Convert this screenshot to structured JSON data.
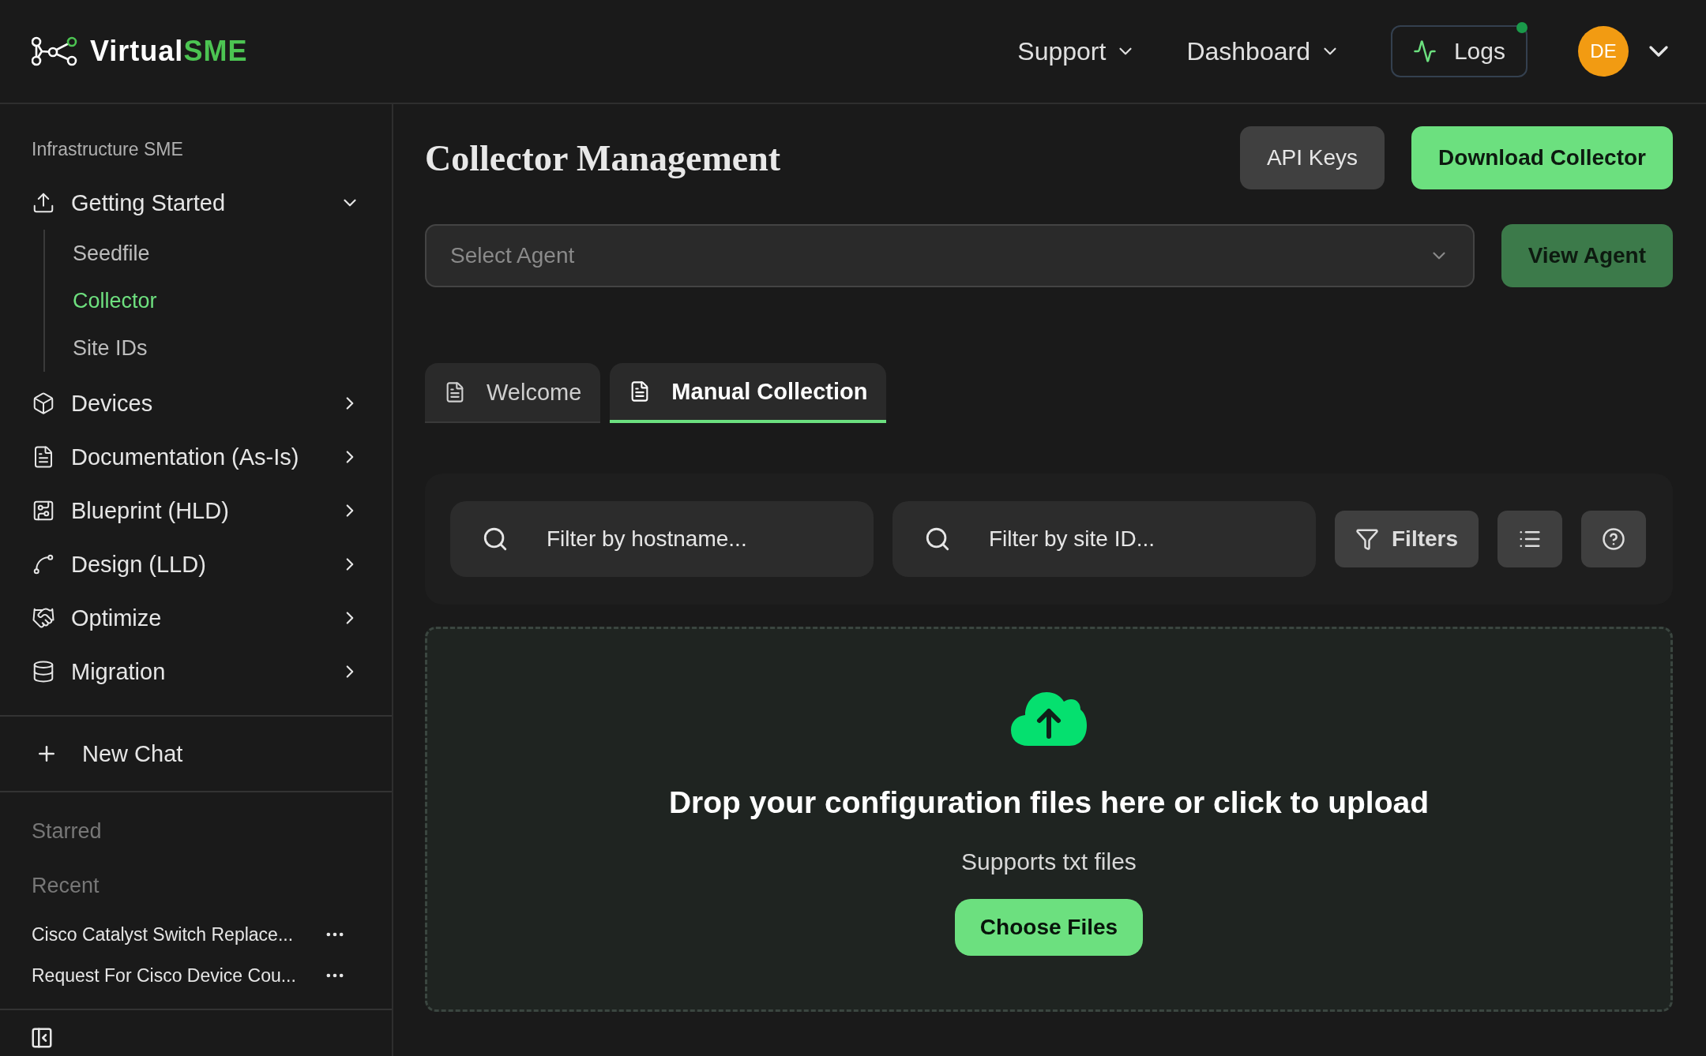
{
  "header": {
    "logo": {
      "part_1": "Virtual",
      "part_2": "SME"
    },
    "nav": [
      {
        "label": "Support"
      },
      {
        "label": "Dashboard"
      }
    ],
    "logs_button": {
      "label": "Logs",
      "notification": true
    },
    "avatar": {
      "initials": "DE"
    }
  },
  "sidebar": {
    "section_title": "Infrastructure SME",
    "items": [
      {
        "label": "Getting Started",
        "expanded": true,
        "children": [
          {
            "label": "Seedfile",
            "selected": false
          },
          {
            "label": "Collector",
            "selected": true
          },
          {
            "label": "Site IDs",
            "selected": false
          }
        ]
      },
      {
        "label": "Devices",
        "expanded": false
      },
      {
        "label": "Documentation (As-Is)",
        "expanded": false
      },
      {
        "label": "Blueprint (HLD)",
        "expanded": false
      },
      {
        "label": "Design (LLD)",
        "expanded": false
      },
      {
        "label": "Optimize",
        "expanded": false
      },
      {
        "label": "Migration",
        "expanded": false
      }
    ],
    "new_chat": "New Chat",
    "starred_title": "Starred",
    "recent_title": "Recent",
    "recent": [
      {
        "title": "Cisco Catalyst Switch Replace..."
      },
      {
        "title": "Request For Cisco Device Cou..."
      }
    ]
  },
  "main": {
    "title": "Collector Management",
    "buttons": [
      {
        "label": "API Keys",
        "kind": "secondary"
      },
      {
        "label": "Download Collector",
        "kind": "primary"
      }
    ],
    "agent_select": {
      "placeholder": "Select Agent"
    },
    "view_agent": "View Agent",
    "tabs": [
      {
        "label": "Welcome",
        "selected": false
      },
      {
        "label": "Manual Collection",
        "selected": true
      }
    ],
    "filters": {
      "hostname_placeholder": "Filter by hostname...",
      "site_placeholder": "Filter by site ID...",
      "filters_button": "Filters"
    },
    "dropzone": {
      "heading": "Drop your configuration files here or click to upload",
      "subtext": "Supports txt files",
      "button": "Choose Files"
    }
  }
}
